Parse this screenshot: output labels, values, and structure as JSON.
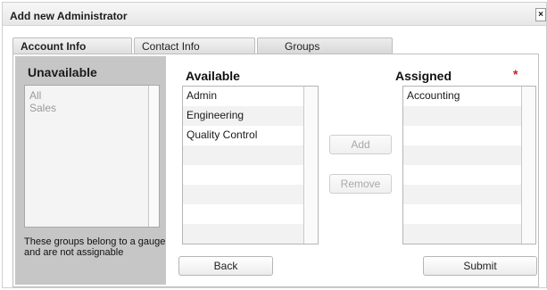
{
  "dialog": {
    "title": "Add new Administrator",
    "close_glyph": "×"
  },
  "tabs": [
    {
      "label": "Account Info"
    },
    {
      "label": "Contact Info"
    },
    {
      "label": "Groups"
    }
  ],
  "unavailable": {
    "header": "Unavailable",
    "items": [
      "All",
      "Sales"
    ],
    "note": "These groups belong to a gauge and are not assignable"
  },
  "available": {
    "header": "Available",
    "items": [
      "Admin",
      "Engineering",
      "Quality Control"
    ]
  },
  "assigned": {
    "header": "Assigned",
    "required_marker": "*",
    "items": [
      "Accounting"
    ]
  },
  "buttons": {
    "add": "Add",
    "remove": "Remove",
    "back": "Back",
    "submit": "Submit"
  },
  "colors": {
    "required": "#d11b1b",
    "unavailable_panel": "#c6c6c6"
  }
}
